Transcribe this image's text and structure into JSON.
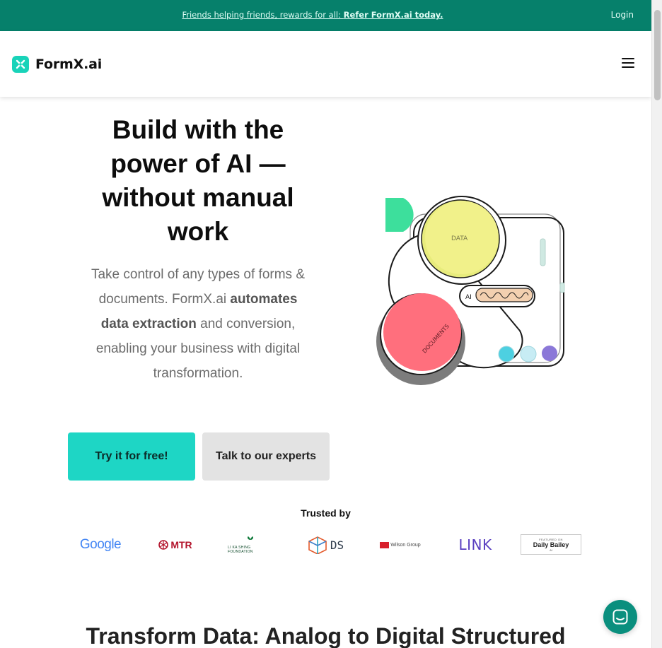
{
  "announcement": {
    "promo_prefix": "Friends helping friends, rewards for all: ",
    "promo_link": "Refer FormX.ai today.",
    "login_label": "Login"
  },
  "header": {
    "brand": "FormX.ai",
    "menu_icon": "hamburger-icon"
  },
  "hero": {
    "title": "Build with the power of AI — without manual work",
    "desc_before": "Take control of any types of forms & documents. FormX.ai ",
    "desc_bold": "automates data extraction",
    "desc_after": " and conversion, enabling your business with digital transformation.",
    "primary_cta": "Try it for free!",
    "secondary_cta": "Talk to our experts",
    "illustration": {
      "data_label": "DATA",
      "documents_label": "DOCUMENTS",
      "ai_label": "AI"
    }
  },
  "trusted": {
    "heading": "Trusted by",
    "logos": [
      {
        "name": "Google",
        "text": "Google"
      },
      {
        "name": "MTR",
        "text": "MTR"
      },
      {
        "name": "Li Ka Shing Foundation",
        "text": "LI KA SHING FOUNDATION"
      },
      {
        "name": "DS",
        "text": "DS"
      },
      {
        "name": "Wilson Group",
        "text": "Wilson Group"
      },
      {
        "name": "LINK",
        "text": "LINK"
      },
      {
        "name": "Daily Bailey AI",
        "text": "Daily Bailey",
        "caption": "FEATURED ON",
        "sub": "AI"
      }
    ]
  },
  "section": {
    "title": "Transform Data: Analog to Digital Structured"
  },
  "colors": {
    "announce_bg": "#06806b",
    "accent": "#1ed6c5",
    "secondary_btn": "#e3e3e3",
    "chat_bubble": "#0a8f7e"
  }
}
